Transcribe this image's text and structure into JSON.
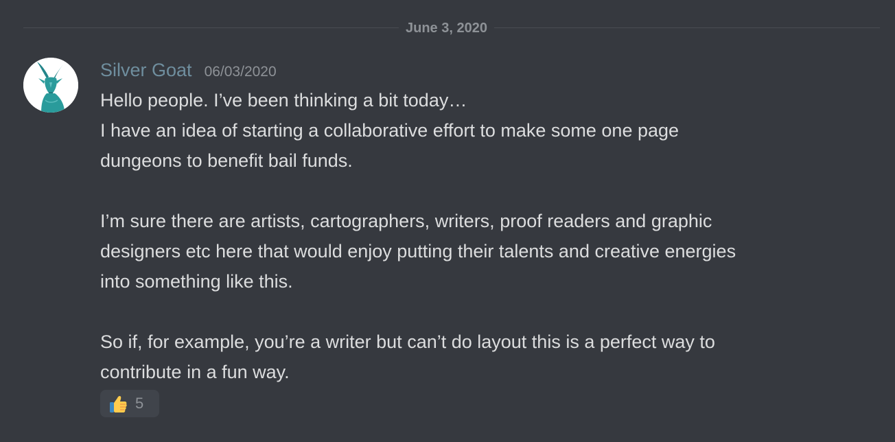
{
  "divider": {
    "date": "June 3, 2020"
  },
  "message": {
    "avatar_icon": "goat-avatar-icon",
    "username": "Silver Goat",
    "timestamp": "06/03/2020",
    "lines": [
      "Hello people. I’ve been thinking a bit today…",
      "I have an idea of starting a collaborative effort to make some one page",
      "dungeons to benefit bail funds.",
      "",
      "I’m sure there are artists, cartographers, writers, proof readers and graphic",
      "designers etc here that would enjoy putting their talents and creative energies",
      "into something like this.",
      "",
      "So if, for example, you’re a writer but can’t do layout this is a perfect way to",
      "contribute in a fun way."
    ],
    "reaction": {
      "icon": "thumbs-up-icon",
      "count": "5"
    }
  },
  "colors": {
    "background": "#36393f",
    "username": "#6f8e9e",
    "text": "#dcddde",
    "muted": "#8e9297",
    "reaction_bg": "#40444b",
    "avatar_teal": "#2a9b9b"
  }
}
